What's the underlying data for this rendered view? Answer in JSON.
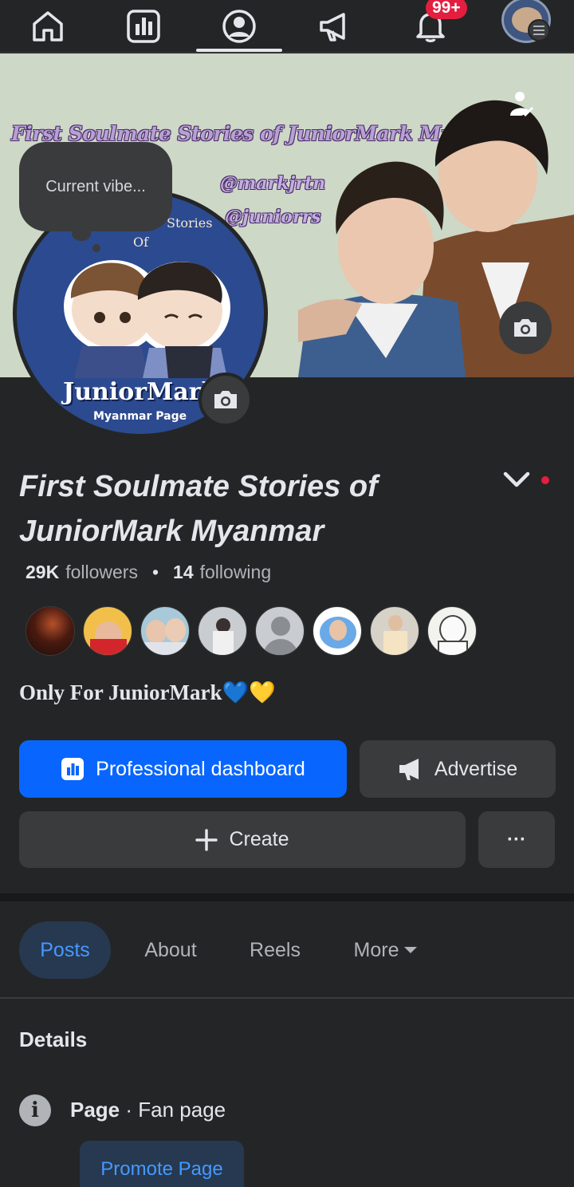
{
  "nav": {
    "items": [
      "home",
      "dashboard",
      "profile",
      "advertise",
      "notifications",
      "account"
    ],
    "active": "profile",
    "notification_badge": "99+"
  },
  "cover": {
    "title": "First Soulmate Stories of JuniorMark Myanmar",
    "handles": [
      "@markjrtn",
      "@juniorrs"
    ]
  },
  "profile_pic": {
    "text_stories": "Stories",
    "text_of": "Of",
    "brand": "JuniorMark",
    "subtitle": "Myanmar Page"
  },
  "vibe_placeholder": "Current vibe...",
  "page": {
    "name": "First Soulmate Stories of JuniorMark Myanmar",
    "followers_count": "29K",
    "followers_label": "followers",
    "following_count": "14",
    "following_label": "following",
    "bio": "Only For JuniorMark💙💛"
  },
  "buttons": {
    "dashboard": "Professional dashboard",
    "advertise": "Advertise",
    "create": "Create",
    "more": "···"
  },
  "tabs": {
    "posts": "Posts",
    "about": "About",
    "reels": "Reels",
    "more": "More"
  },
  "details": {
    "title": "Details",
    "page_label": "Page",
    "page_type": "· Fan page",
    "promote": "Promote Page"
  },
  "colors": {
    "background": "#242526",
    "primary": "#0866ff",
    "secondary": "#3a3b3c",
    "accent_tab": "#4599ff",
    "badge": "#e41e3f"
  }
}
